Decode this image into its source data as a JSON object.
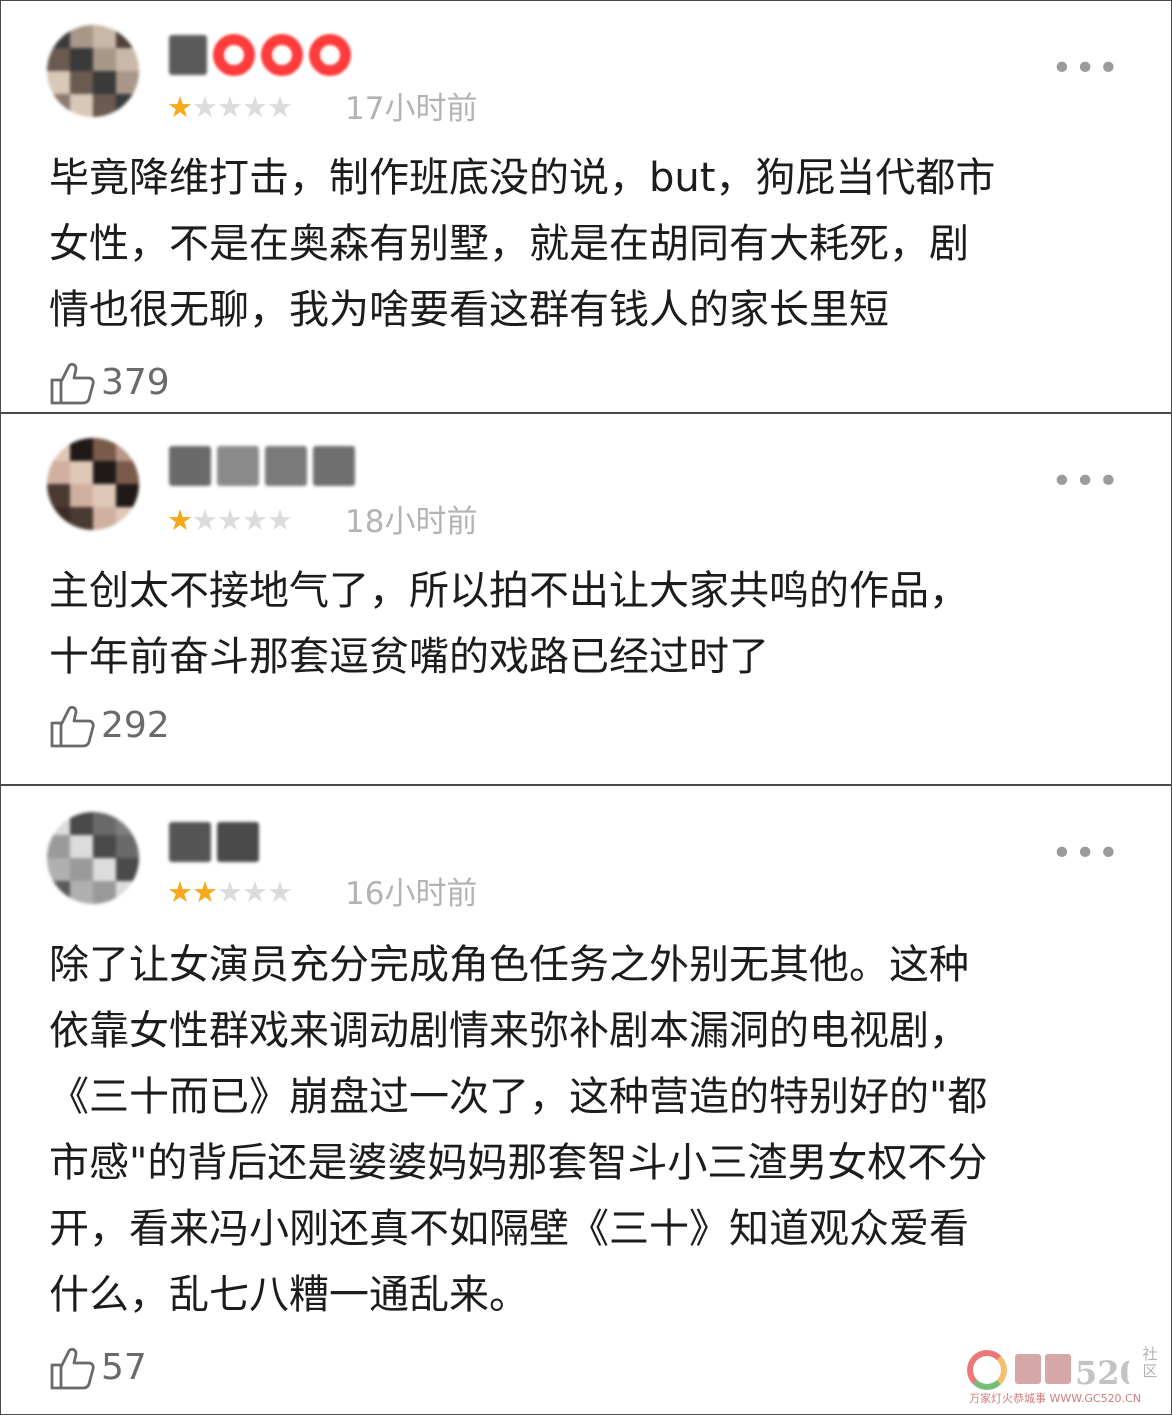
{
  "colors": {
    "star_on": "#f7a81b",
    "star_off": "#dcdcdc",
    "timestamp": "#b3b3b3",
    "border": "#4a4a4a"
  },
  "reviews": [
    {
      "rating": 1,
      "max_rating": 5,
      "time": "17小时前",
      "content": "毕竟降维打击，制作班底没的说，but，狗屁当代都市\n女性，不是在奥森有别墅，就是在胡同有大耗死，剧\n情也很无聊，我为啥要看这群有钱人的家长里短",
      "likes": "379"
    },
    {
      "rating": 1,
      "max_rating": 5,
      "time": "18小时前",
      "content": "主创太不接地气了，所以拍不出让大家共鸣的作品，\n十年前奋斗那套逗贫嘴的戏路已经过时了",
      "likes": "292"
    },
    {
      "rating": 2,
      "max_rating": 5,
      "time": "16小时前",
      "content": "除了让女演员充分完成角色任务之外别无其他。这种\n依靠女性群戏来调动剧情来弥补剧本漏洞的电视剧，\n《三十而已》崩盘过一次了，这种营造的特别好的\"都\n市感\"的背后还是婆婆妈妈那套智斗小三渣男女权不分\n开，看来冯小刚还真不如隔壁《三十》知道观众爱看\n什么，乱七八糟一通乱来。",
      "likes": "57"
    }
  ],
  "more_icon": "ellipsis-icon",
  "like_icon": "thumbs-up-icon",
  "watermark": {
    "side_text": "社区",
    "sub_text": "万家灯火恭城事 WWW.GC520.CN"
  }
}
